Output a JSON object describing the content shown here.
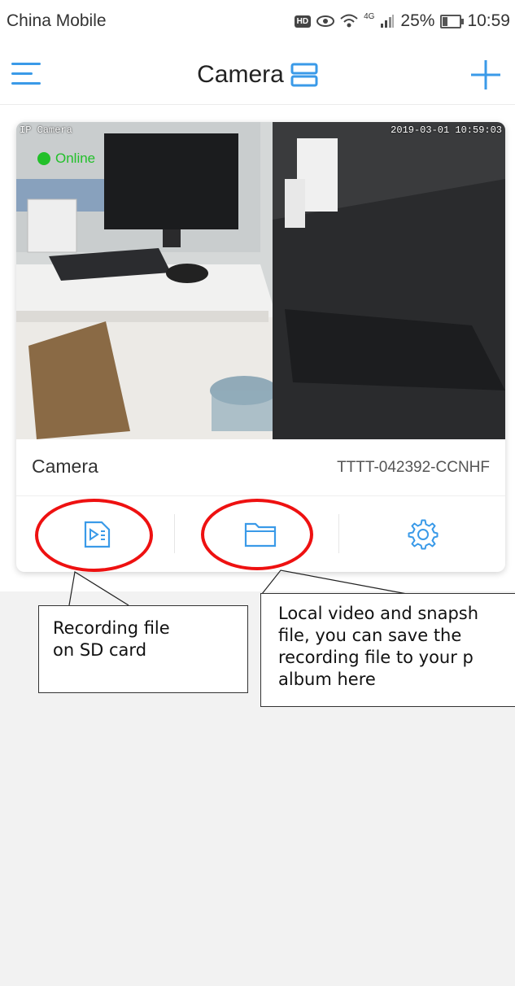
{
  "status_bar": {
    "carrier": "China Mobile",
    "hd_badge": "HD",
    "network": "4G",
    "battery_percent": "25%",
    "time": "10:59"
  },
  "header": {
    "title": "Camera",
    "menu_icon": "menu-icon",
    "layout_icon": "split-view-icon",
    "add_icon": "plus-icon",
    "accent_color": "#3a9ae8"
  },
  "camera_card": {
    "osd_left": "IP Camera",
    "osd_timestamp": "2019-03-01 10:59:03",
    "status": "Online",
    "status_color": "#22c02a",
    "name": "Camera",
    "device_id": "TTTT-042392-CCNHF",
    "actions": [
      {
        "icon": "sd-recording-icon"
      },
      {
        "icon": "folder-icon"
      },
      {
        "icon": "gear-icon"
      }
    ]
  },
  "annotations": {
    "highlight_color": "#ee1111",
    "recording": {
      "lines": [
        "Recording file",
        "on SD card"
      ]
    },
    "local": {
      "lines": [
        "Local video and snapsh",
        "file, you can save the",
        "recording file to your p",
        "album here"
      ]
    }
  }
}
